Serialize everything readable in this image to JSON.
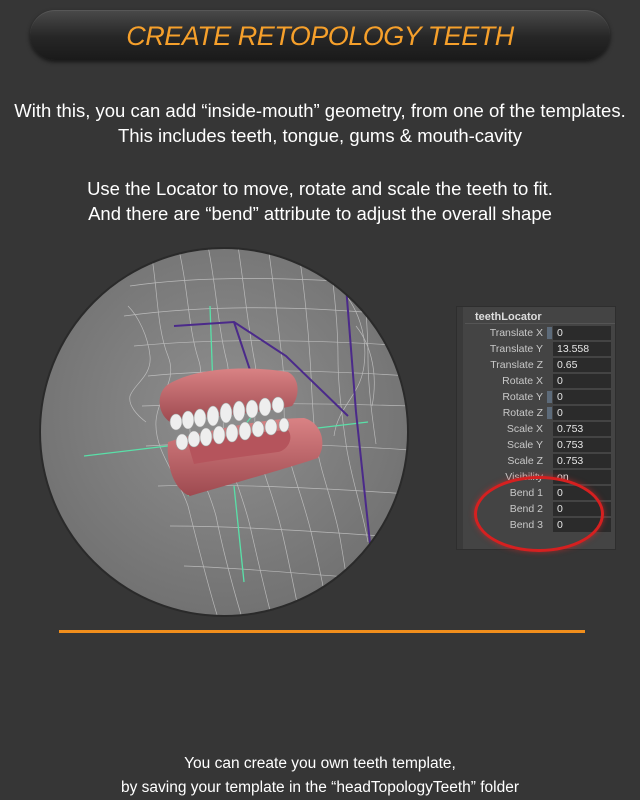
{
  "title": "CREATE RETOPOLOGY TEETH",
  "intro": {
    "line1": "With this, you can add “inside-mouth” geometry, from one of the templates.",
    "line2": "This includes teeth, tongue, gums & mouth-cavity"
  },
  "locator_info": {
    "line1": "Use the Locator to move, rotate and scale the teeth to fit.",
    "line2": "And there are “bend” attribute to adjust the overall shape"
  },
  "attribute_panel": {
    "title": "teethLocator",
    "rows": [
      {
        "label": "Translate X",
        "value": "0"
      },
      {
        "label": "Translate Y",
        "value": "13.558"
      },
      {
        "label": "Translate Z",
        "value": "0.65"
      },
      {
        "label": "Rotate X",
        "value": "0"
      },
      {
        "label": "Rotate Y",
        "value": "0"
      },
      {
        "label": "Rotate Z",
        "value": "0"
      },
      {
        "label": "Scale X",
        "value": "0.753"
      },
      {
        "label": "Scale Y",
        "value": "0.753"
      },
      {
        "label": "Scale Z",
        "value": "0.753"
      },
      {
        "label": "Visibility",
        "value": "on"
      },
      {
        "label": "Bend 1",
        "value": "0"
      },
      {
        "label": "Bend 2",
        "value": "0"
      },
      {
        "label": "Bend 3",
        "value": "0"
      }
    ]
  },
  "footer": {
    "line1": "You can create you own teeth template,",
    "line2": "by saving your template in the “headTopologyTeeth” folder"
  },
  "colors": {
    "accent": "#f6a02b",
    "divider": "#f18e1c",
    "highlight_ring": "#d62020",
    "background": "#363636"
  }
}
